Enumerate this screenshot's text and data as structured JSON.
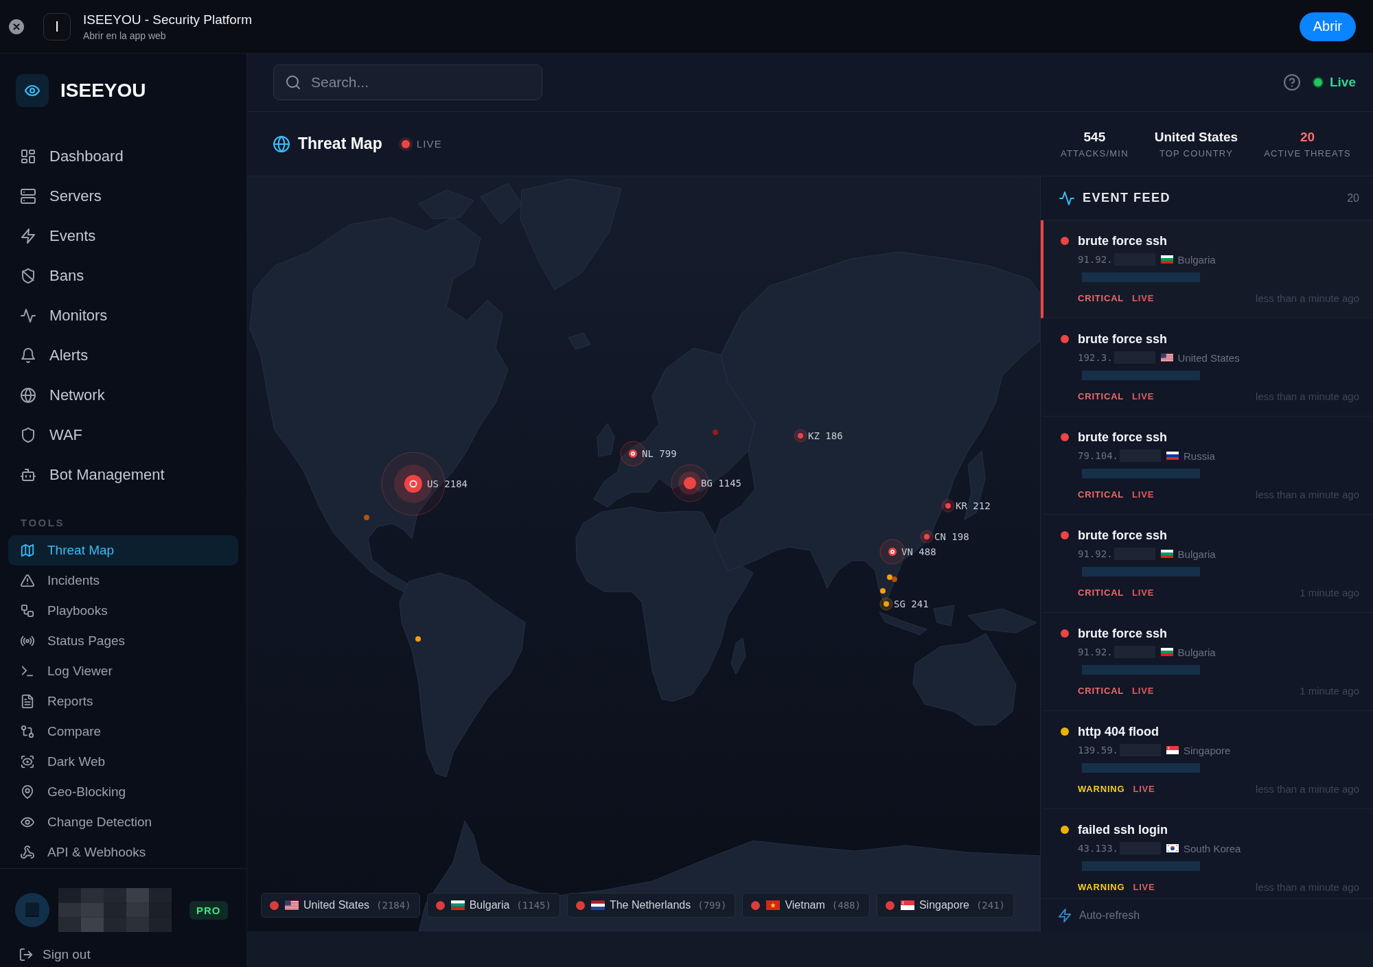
{
  "app_banner": {
    "app_icon": "I",
    "title": "ISEEYOU - Security Platform",
    "subtitle": "Abrir en la app web",
    "open_button": "Abrir"
  },
  "sidebar": {
    "brand": "ISEEYOU",
    "nav_items": [
      {
        "label": "Dashboard",
        "selected": false
      },
      {
        "label": "Servers",
        "selected": false
      },
      {
        "label": "Events",
        "selected": false
      },
      {
        "label": "Bans",
        "selected": false
      },
      {
        "label": "Monitors",
        "selected": false
      },
      {
        "label": "Alerts",
        "selected": false
      },
      {
        "label": "Network",
        "selected": false
      },
      {
        "label": "WAF",
        "selected": false
      },
      {
        "label": "Bot Management",
        "selected": false
      }
    ],
    "tools_heading": "TOOLS",
    "tool_items": [
      {
        "label": "Threat Map",
        "selected": true
      },
      {
        "label": "Incidents",
        "selected": false
      },
      {
        "label": "Playbooks",
        "selected": false
      },
      {
        "label": "Status Pages",
        "selected": false
      },
      {
        "label": "Log Viewer",
        "selected": false
      },
      {
        "label": "Reports",
        "selected": false
      },
      {
        "label": "Compare",
        "selected": false
      },
      {
        "label": "Dark Web",
        "selected": false
      },
      {
        "label": "Geo-Blocking",
        "selected": false
      },
      {
        "label": "Change Detection",
        "selected": false
      },
      {
        "label": "API & Webhooks",
        "selected": false
      }
    ],
    "plan_badge": "PRO",
    "sign_out": "Sign out"
  },
  "top_bar": {
    "search": {
      "placeholder": "Search..."
    },
    "status": "Live"
  },
  "page_header": {
    "title": "Threat Map",
    "live_badge": "LIVE",
    "stats": [
      {
        "value": "545",
        "label": "ATTACKS/MIN",
        "kind": "neutral"
      },
      {
        "value": "United States",
        "label": "TOP COUNTRY",
        "kind": "neutral"
      },
      {
        "value": "20",
        "label": "ACTIVE THREATS",
        "kind": "alert"
      }
    ]
  },
  "threat_map": {
    "markers": [
      {
        "label": "US 2184",
        "kind": "major",
        "color": "#ef4444"
      },
      {
        "label": "NL 799",
        "kind": "medium",
        "color": "#ef4444"
      },
      {
        "label": "BG 1145",
        "kind": "large",
        "color": "#ef4444"
      },
      {
        "label": "KZ 186",
        "kind": "small",
        "color": "#ef4444"
      },
      {
        "label": "KR 212",
        "kind": "small",
        "color": "#ef4444"
      },
      {
        "label": "CN 198",
        "kind": "small",
        "color": "#ef4444"
      },
      {
        "label": "VN 488",
        "kind": "medium",
        "color": "#ef4444"
      },
      {
        "label": "SG 241",
        "kind": "small",
        "color": "#f59e0b"
      }
    ],
    "minor_dots": [
      {
        "color": "#b45309"
      },
      {
        "color": "#f59e0b"
      },
      {
        "color": "#f59e0b"
      },
      {
        "color": "#b45309"
      },
      {
        "color": "#f59e0b"
      },
      {
        "color": "#991b1b"
      }
    ],
    "legend": [
      {
        "kind": "us",
        "country": "United States",
        "count": "(2184)"
      },
      {
        "kind": "bg",
        "country": "Bulgaria",
        "count": "(1145)"
      },
      {
        "kind": "nl",
        "country": "The Netherlands",
        "count": "(799)"
      },
      {
        "kind": "vn",
        "country": "Vietnam",
        "count": "(488)"
      },
      {
        "kind": "sg",
        "country": "Singapore",
        "count": "(241)"
      }
    ]
  },
  "event_feed": {
    "title": "EVENT FEED",
    "count": "20",
    "items": [
      {
        "title": "brute force ssh",
        "ip": "91.92.",
        "origin": {
          "kind": "bg",
          "country": "Bulgaria"
        },
        "severity": {
          "kind": "critical",
          "label": "CRITICAL"
        },
        "tag": "LIVE",
        "time": "less than a minute ago",
        "selected": true
      },
      {
        "title": "brute force ssh",
        "ip": "192.3.",
        "origin": {
          "kind": "us",
          "country": "United States"
        },
        "severity": {
          "kind": "critical",
          "label": "CRITICAL"
        },
        "tag": "LIVE",
        "time": "less than a minute ago",
        "selected": false
      },
      {
        "title": "brute force ssh",
        "ip": "79.104.",
        "origin": {
          "kind": "ru",
          "country": "Russia"
        },
        "severity": {
          "kind": "critical",
          "label": "CRITICAL"
        },
        "tag": "LIVE",
        "time": "less than a minute ago",
        "selected": false
      },
      {
        "title": "brute force ssh",
        "ip": "91.92.",
        "origin": {
          "kind": "bg",
          "country": "Bulgaria"
        },
        "severity": {
          "kind": "critical",
          "label": "CRITICAL"
        },
        "tag": "LIVE",
        "time": "1 minute ago",
        "selected": false
      },
      {
        "title": "brute force ssh",
        "ip": "91.92.",
        "origin": {
          "kind": "bg",
          "country": "Bulgaria"
        },
        "severity": {
          "kind": "critical",
          "label": "CRITICAL"
        },
        "tag": "LIVE",
        "time": "1 minute ago",
        "selected": false
      },
      {
        "title": "http 404 flood",
        "ip": "139.59.",
        "origin": {
          "kind": "sg",
          "country": "Singapore"
        },
        "severity": {
          "kind": "warning",
          "label": "WARNING"
        },
        "tag": "LIVE",
        "time": "less than a minute ago",
        "selected": false
      },
      {
        "title": "failed ssh login",
        "ip": "43.133.",
        "origin": {
          "kind": "kr",
          "country": "South Korea"
        },
        "severity": {
          "kind": "warning",
          "label": "WARNING"
        },
        "tag": "LIVE",
        "time": "less than a minute ago",
        "selected": false
      }
    ],
    "footer": "Auto-refresh"
  }
}
